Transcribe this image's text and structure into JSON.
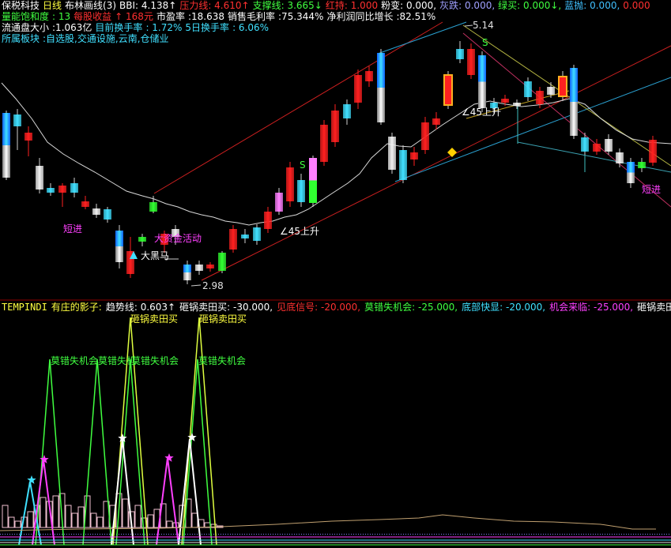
{
  "header": {
    "line1": {
      "stock_name": "保税科技",
      "period": "日线",
      "indicator_name": "布林画线(3)",
      "bbi_label": "BBI: 4.138↑",
      "pressure_label": "压力线: 4.610↑",
      "support_label": "支撑线: 3.665↓",
      "red_hold_label": "红持: 1.000",
      "pink_change_label": "粉变: 0.000,",
      "gray_fall_label": "灰跌: 0.000,",
      "green_buy_label": "绿买: 0.000↓,",
      "blue_throw_label": "蓝抛: 0.000,",
      "tail_label": "0.000"
    },
    "line2": {
      "volume_label": "量能饱和度",
      "volume_value": ": 13",
      "eps_label": "每股收益",
      "eps_value": "↑ 168元",
      "pe_label": "市盈率",
      "pe_value": ":18.638",
      "gross_margin_label": "销售毛利率",
      "gross_margin_value": ":75.344%",
      "net_growth_label": "净利润同比增长",
      "net_growth_value": ":82.51%"
    },
    "line3": {
      "float_label": "流通盘大小",
      "float_value": ":1.063亿",
      "turnover_label": "目前换手率",
      "turnover_value": ": 1.72%",
      "turnover5_label": "5日换手率",
      "turnover5_value": ": 6.06%"
    },
    "line4": {
      "sector_label": "所属板块",
      "sector_value": ":自选股,交通设施,云南,仓储业"
    }
  },
  "annotations": {
    "high_price": "5.14",
    "low_price": "2.98",
    "duan_jin_1": "短进",
    "duan_jin_2": "短进",
    "main_force": "大资金活动",
    "dark_horse": "大黑马",
    "rise45_1": "∠45上升",
    "rise45_2": "∠45上升",
    "s1": "S",
    "s2": "S"
  },
  "sub_header": {
    "name": "TEMPINDI",
    "title": "有庄的影子:",
    "trend_label": "趋势线: 0.603↑",
    "pot_sell_label": "砸锅卖田买: -30.000,",
    "bottom_signal_label": "见底信号: -20.000,",
    "missed_chance_label": "莫错失机会: -25.000,",
    "bottom_show_label": "底部快显: -20.000,",
    "chance_label": "机会来临: -25.000,",
    "tail_label": "砸锅卖田"
  },
  "sub_annotations": {
    "sell_buy_1": "砸锅卖田买",
    "sell_buy_2": "砸锅卖田买",
    "missed_1": "莫错失机会",
    "missed_2": "莫错失机",
    "missed_3": "莫错失机会",
    "missed_4": "莫错失机会"
  },
  "colors": {
    "bg": "#000000",
    "up": "#ff3030",
    "down": "#54ffff",
    "red_text": "#ff4040",
    "magenta": "#ff40ff",
    "yellow": "#ffff00",
    "green": "#40ff40",
    "cyan": "#40e0ff",
    "white": "#ffffff",
    "pink": "#ff80ff",
    "divider": "#c00000"
  }
}
